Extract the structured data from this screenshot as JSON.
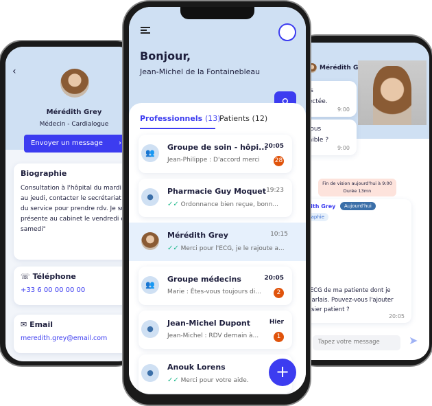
{
  "profile": {
    "name": "Mérédith Grey",
    "role": "Médecin - Cardialogue",
    "send_button": "Envoyer un message",
    "bio_title": "Biographie",
    "bio_text": "Consultation à l'hôpital du mardi au jeudi, contacter le secrétariat du service pour prendre rdv. Je suis présente au cabinet le vendredi et samedi\"",
    "phone_title": "Téléphone",
    "phone": "+33 6 00 00 00 00",
    "email_title": "Email",
    "email": "meredith.grey@email.com"
  },
  "home": {
    "greeting": "Bonjour,",
    "user": "Jean-Michel de la Fontainebleau",
    "tabs": [
      {
        "label": "Professionnels",
        "count": "(13)"
      },
      {
        "label": "Patients",
        "count": "(12)"
      }
    ],
    "conversations": [
      {
        "name": "Groupe de soin - hôpi...",
        "time": "20:05",
        "preview": "Jean-Philippe : D'accord merci",
        "unread": "28",
        "type": "group"
      },
      {
        "name": "Pharmacie Guy Moquet",
        "time": "19:23",
        "preview": "Ordonnance bien reçue, bonn...",
        "read": true,
        "type": "person"
      },
      {
        "name": "Mérédith Grey",
        "time": "10:15",
        "preview": "Merci pour l'ECG, je le rajoute a...",
        "read": true,
        "type": "photo"
      },
      {
        "name": "Groupe médecins",
        "time": "20:05",
        "preview": "Marie : Êtes-vous toujours di...",
        "unread": "2",
        "type": "group"
      },
      {
        "name": "Jean-Michel Dupont",
        "time": "Hier",
        "preview": "Jean-Michel : RDV demain à...",
        "unread": "1",
        "type": "person"
      },
      {
        "name": "Anouk Lorens",
        "time": "",
        "preview": "Merci pour votre aide.",
        "read": true,
        "type": "person"
      }
    ],
    "fab": "+"
  },
  "chat": {
    "contact": "Mérédith Grey",
    "msg1": "uis\nnectée.",
    "time1": "9:00",
    "msg2": "-vous\nonible ?",
    "time2": "9:00",
    "notice": "Fin de vision aujourd'hui à 9:00\nDurée 13mn",
    "sender": "édith Grey",
    "today": "Aujourd'hui",
    "tag": "ographie",
    "msg3": "i l'ECG de ma patiente dont je\ns parlais. Pouvez-vous l'ajouter\nlossier patient ?",
    "time3": "20:05",
    "input_placeholder": "Tapez votre message"
  },
  "colors": {
    "accent": "#3c3cf0",
    "header": "#cfe0f3",
    "badge": "#e0530b",
    "read": "#1fb98c"
  }
}
